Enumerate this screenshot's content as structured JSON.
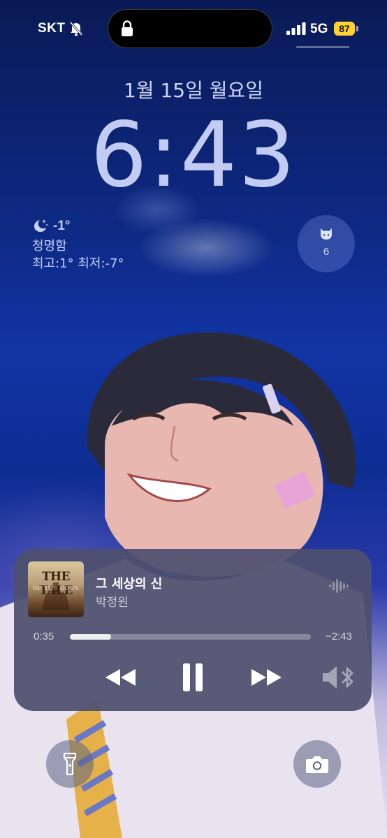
{
  "status_bar": {
    "carrier": "SKT",
    "network": "5G",
    "battery_percent": "87",
    "battery_color": "#ffd230",
    "icons": [
      "silent-mode-icon",
      "lock-icon",
      "signal-icon"
    ]
  },
  "lock_screen": {
    "date": "1월 15일 월요일",
    "time": "6:43"
  },
  "weather": {
    "icon": "moon-stars-icon",
    "temperature": "-1°",
    "condition": "청명함",
    "range": "최고:1° 최저:-7°"
  },
  "cat_widget": {
    "icon": "cat-face-icon",
    "count": "6"
  },
  "now_playing": {
    "album_art_text": "THE TALE",
    "album_art_subtitle": "OF THE GODS",
    "title": "그 세상의 신",
    "artist": "박정원",
    "elapsed": "0:35",
    "remaining": "−2:43",
    "progress_fraction": 0.17,
    "controls": [
      "rewind-icon",
      "pause-icon",
      "forward-icon",
      "speaker-bluetooth-icon"
    ]
  },
  "quick_actions": {
    "left": "flashlight-icon",
    "right": "camera-icon"
  }
}
